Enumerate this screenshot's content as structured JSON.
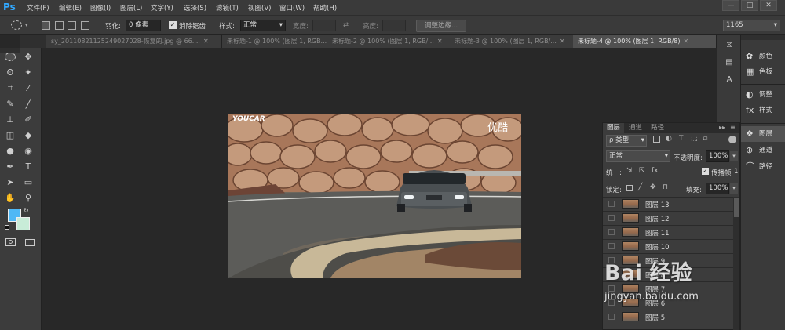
{
  "app": {
    "logo": "Ps"
  },
  "menu": [
    "文件(F)",
    "编辑(E)",
    "图像(I)",
    "图层(L)",
    "文字(Y)",
    "选择(S)",
    "滤镜(T)",
    "视图(V)",
    "窗口(W)",
    "帮助(H)"
  ],
  "window_controls": [
    "—",
    "□",
    "✕"
  ],
  "options": {
    "feather_label": "羽化:",
    "feather_value": "0 像素",
    "antialias_label": "消除锯齿",
    "style_label": "样式:",
    "style_value": "正常",
    "width_label": "宽度:",
    "height_label": "高度:",
    "refine_edge": "调整边缘...",
    "workspace": "1165"
  },
  "tabs": [
    "sy_20110821125249027028-恢复的.jpg @ 66....",
    "未标题-1 @ 100% (图层 1, RGB...",
    "未标题-2 @ 100% (图层 1, RGB/...",
    "未标题-3 @ 100% (图层 1, RGB/...",
    "未标题-4 @ 100% (图层 1, RGB/8)"
  ],
  "canvas": {
    "watermark_left": "YOUCAR",
    "watermark_right": "优酷"
  },
  "dock": {
    "group1": [
      {
        "icon": "color-icon",
        "label": "颜色"
      },
      {
        "icon": "swatches-icon",
        "label": "色板"
      }
    ],
    "group2": [
      {
        "icon": "adjustments-icon",
        "label": "调整"
      },
      {
        "icon": "styles-icon",
        "label": "样式"
      }
    ],
    "group3": [
      {
        "icon": "layers-icon",
        "label": "图层"
      },
      {
        "icon": "channels-icon",
        "label": "通道"
      },
      {
        "icon": "paths-icon",
        "label": "路径"
      }
    ]
  },
  "layers_panel": {
    "tabs": [
      "图层",
      "通道",
      "路径"
    ],
    "kind_filter": "ρ 类型",
    "blend_mode": "正常",
    "opacity_label": "不透明度:",
    "opacity_value": "100%",
    "unify_label": "统一:",
    "propagate_label": "传播帧",
    "propagate_value": "1",
    "lock_label": "锁定:",
    "fill_label": "填充:",
    "fill_value": "100%",
    "rows": [
      "图层 13",
      "图层 12",
      "图层 11",
      "图层 10",
      "图层 9",
      "图层 8",
      "图层 7",
      "图层 6",
      "图层 5"
    ]
  },
  "watermark": {
    "text": "Bai 经验",
    "url": "jingyan.baidu.com"
  },
  "colors": {
    "accent": "#31a8ff",
    "foreground": "#4fb8f5",
    "background": "#c8ecd8"
  }
}
